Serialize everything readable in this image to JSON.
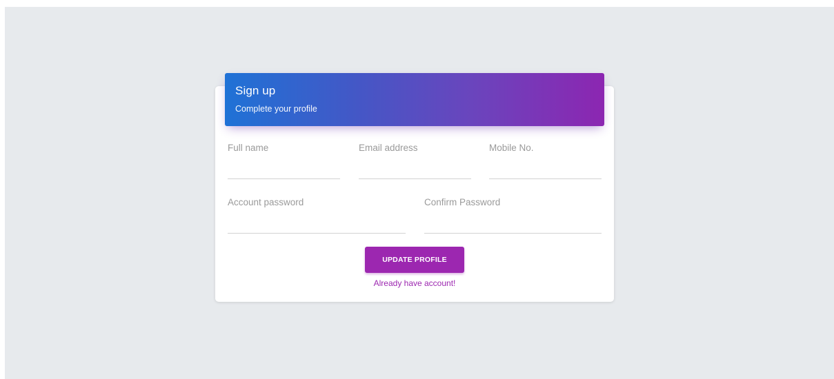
{
  "header": {
    "title": "Sign up",
    "subtitle": "Complete your profile"
  },
  "fields": {
    "full_name": {
      "label": "Full name",
      "value": ""
    },
    "email": {
      "label": "Email address",
      "value": ""
    },
    "mobile": {
      "label": "Mobile No.",
      "value": ""
    },
    "password": {
      "label": "Account password",
      "value": ""
    },
    "confirm_password": {
      "label": "Confirm Password",
      "value": ""
    }
  },
  "actions": {
    "submit_label": "UPDATE PROFILE",
    "login_link": "Already have account!"
  },
  "colors": {
    "page_background": "#e7eaed",
    "card_background": "#ffffff",
    "header_gradient_start": "#1f72d6",
    "header_gradient_end": "#8c26b1",
    "accent": "#9c27b0",
    "label": "#9a9a9a"
  }
}
